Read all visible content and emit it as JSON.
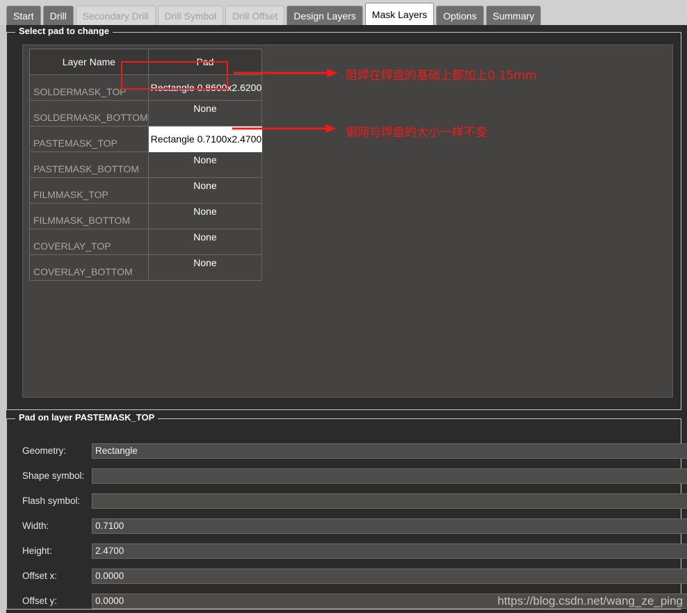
{
  "window": {
    "watermark": "https://blog.csdn.net/wang_ze_ping",
    "accent_red": "#ee1c1c",
    "bg": "#2b2b2b",
    "panel_bg": "#454341"
  },
  "tabs": [
    {
      "label": "Start",
      "state": "enabled"
    },
    {
      "label": "Drill",
      "state": "enabled"
    },
    {
      "label": "Secondary Drill",
      "state": "disabled"
    },
    {
      "label": "Drill Symbol",
      "state": "disabled"
    },
    {
      "label": "Drill Offset",
      "state": "disabled"
    },
    {
      "label": "Design Layers",
      "state": "enabled"
    },
    {
      "label": "Mask Layers",
      "state": "active"
    },
    {
      "label": "Options",
      "state": "enabled"
    },
    {
      "label": "Summary",
      "state": "enabled"
    }
  ],
  "select_group": {
    "title": "Select pad to change",
    "table": {
      "columns": [
        "Layer Name",
        "Pad"
      ],
      "rows": [
        {
          "layer": "SOLDERMASK_TOP",
          "pad": "Rectangle 0.8600x2.6200",
          "style": "leftal"
        },
        {
          "layer": "SOLDERMASK_BOTTOM",
          "pad": "None",
          "style": "normal"
        },
        {
          "layer": "PASTEMASK_TOP",
          "pad": "Rectangle 0.7100x2.4700",
          "style": "editing"
        },
        {
          "layer": "PASTEMASK_BOTTOM",
          "pad": "None",
          "style": "normal"
        },
        {
          "layer": "FILMMASK_TOP",
          "pad": "None",
          "style": "normal"
        },
        {
          "layer": "FILMMASK_BOTTOM",
          "pad": "None",
          "style": "normal"
        },
        {
          "layer": "COVERLAY_TOP",
          "pad": "None",
          "style": "normal"
        },
        {
          "layer": "COVERLAY_BOTTOM",
          "pad": "None",
          "style": "normal"
        }
      ]
    }
  },
  "annotations": [
    {
      "text": "阻焊在焊盘的基础上都加上0.15mm"
    },
    {
      "text": "钢网与焊盘的大小一样不变"
    }
  ],
  "pad_group": {
    "title": "Pad on layer PASTEMASK_TOP",
    "fields": [
      {
        "label": "Geometry:",
        "value": "Rectangle"
      },
      {
        "label": "Shape symbol:",
        "value": ""
      },
      {
        "label": "Flash symbol:",
        "value": ""
      },
      {
        "label": "Width:",
        "value": "0.7100"
      },
      {
        "label": "Height:",
        "value": "2.4700"
      },
      {
        "label": "Offset x:",
        "value": "0.0000"
      },
      {
        "label": "Offset y:",
        "value": "0.0000"
      }
    ]
  }
}
